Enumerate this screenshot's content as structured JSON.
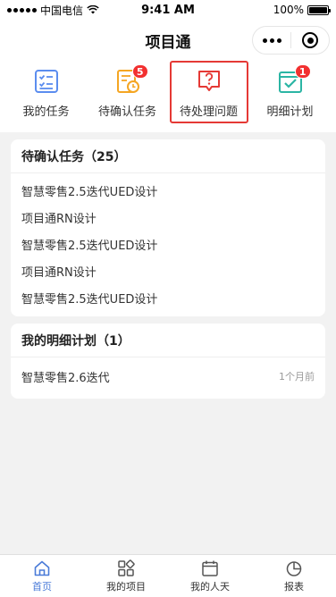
{
  "status_bar": {
    "carrier": "中国电信",
    "time": "9:41 AM",
    "battery_text": "100%",
    "battery_level": 1.0
  },
  "nav": {
    "title": "项目通",
    "more_icon": "more-dots-icon",
    "close_icon": "target-circle-icon"
  },
  "quick_nav": [
    {
      "label": "我的任务",
      "icon": "task-list-icon",
      "color": "#5b8def",
      "badge": ""
    },
    {
      "label": "待确认任务",
      "icon": "clock-document-icon",
      "color": "#f5a623",
      "badge": "5"
    },
    {
      "label": "待处理问题",
      "icon": "question-bubble-icon",
      "color": "#e53935",
      "badge": ""
    },
    {
      "label": "明细计划",
      "icon": "check-calendar-icon",
      "color": "#2bb5a4",
      "badge": "1"
    }
  ],
  "pending_tasks": {
    "title": "待确认任务（25）",
    "items": [
      "智慧零售2.5迭代UED设计",
      "项目通RN设计",
      "智慧零售2.5迭代UED设计",
      "项目通RN设计",
      "智慧零售2.5迭代UED设计"
    ]
  },
  "detail_plans": {
    "title": "我的明细计划（1）",
    "items": [
      {
        "name": "智慧零售2.6迭代",
        "time": "1个月前"
      }
    ]
  },
  "tabs": [
    {
      "label": "首页",
      "icon": "home-icon",
      "active": true
    },
    {
      "label": "我的项目",
      "icon": "apps-icon",
      "active": false
    },
    {
      "label": "我的人天",
      "icon": "calendar-icon",
      "active": false
    },
    {
      "label": "报表",
      "icon": "pie-chart-icon",
      "active": false
    }
  ],
  "colors": {
    "accent": "#4a7bd8",
    "badge": "#f23030",
    "highlight": "#e53935"
  }
}
